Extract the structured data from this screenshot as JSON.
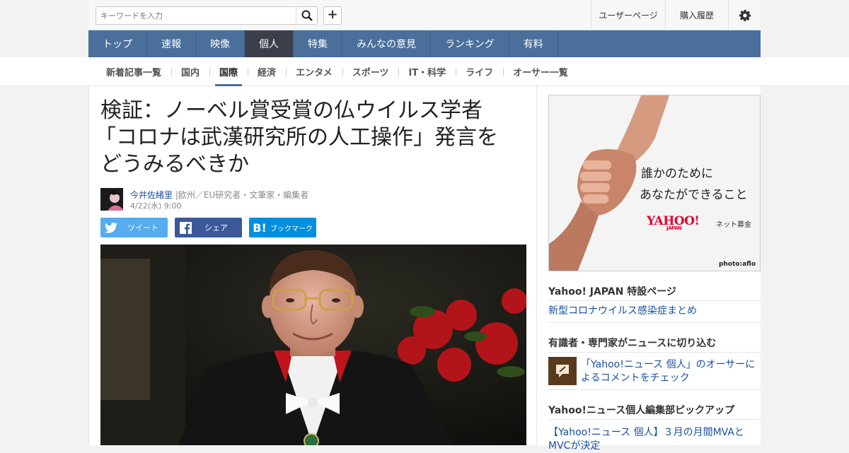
{
  "header": {
    "search_placeholder": "キーワードを入力",
    "user_page": "ユーザーページ",
    "purchase_history": "購入履歴"
  },
  "global_nav": [
    "トップ",
    "速報",
    "映像",
    "個人",
    "特集",
    "みんなの意見",
    "ランキング",
    "有料"
  ],
  "global_nav_active": "個人",
  "sub_nav": [
    "新着記事一覧",
    "国内",
    "国際",
    "経済",
    "エンタメ",
    "スポーツ",
    "IT・科学",
    "ライフ",
    "オーサー一覧"
  ],
  "sub_nav_active": "国際",
  "article": {
    "title_lines": [
      "検証：ノーベル賞受賞の仏ウイルス学者",
      "「コロナは武漢研究所の人工操作」発言を",
      "どうみるべきか"
    ],
    "author_name": "今井佐緒里",
    "author_role": "|欧州／EU研究者・文筆家・編集者",
    "date": "4/22(水) 9:00",
    "share": {
      "twitter": "ツイート",
      "facebook": "シェア",
      "hatena": "ブックマーク"
    }
  },
  "sidebar": {
    "ad": {
      "line1": "誰かのために",
      "line2": "あなたができること",
      "logo": "YAHOO!",
      "logo_sub": "JAPAN",
      "service": "ネット募金",
      "credit": "photo:aflo"
    },
    "special_heading": "Yahoo! JAPAN 特設ページ",
    "special_link": "新型コロナウイルス感染症まとめ",
    "experts_heading": "有識者・専門家がニュースに切り込む",
    "experts_link": "「Yahoo!ニュース 個人」のオーサーによるコメントをチェック",
    "pickup_heading": "Yahoo!ニュース個人編集部ピックアップ",
    "pickup_link": "【Yahoo!ニュース 個人】３月の月間MVAとMVCが決定"
  },
  "colors": {
    "nav_bg": "#4a6f9a",
    "nav_active": "#3a3f49",
    "twitter": "#55acee",
    "facebook": "#3b5998",
    "hatena": "#008fde",
    "link": "#1a4fa0"
  }
}
